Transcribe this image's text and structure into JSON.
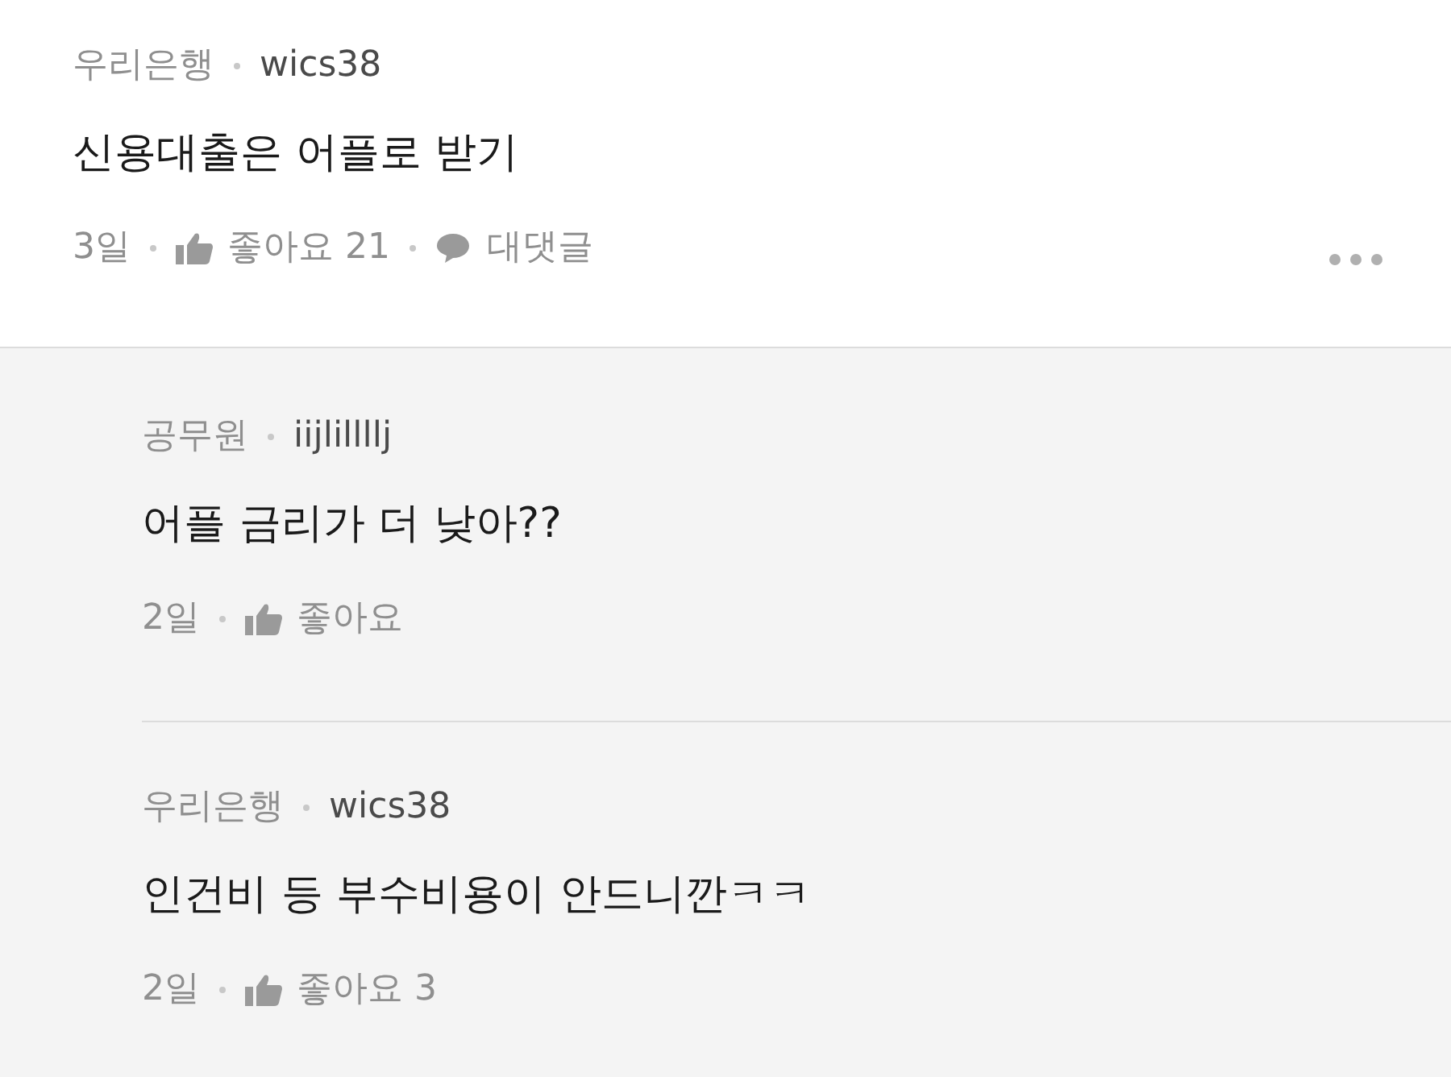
{
  "comment": {
    "group": "우리은행",
    "user": "wics38",
    "text": "신용대출은 어플로 받기",
    "age": "3일",
    "likes": "좋아요 21",
    "reply": "대댓글"
  },
  "replies": [
    {
      "group": "공무원",
      "user": "iijlillllj",
      "text": "어플 금리가 더 낮아??",
      "age": "2일",
      "likes": "좋아요"
    },
    {
      "group": "우리은행",
      "user": "wics38",
      "text": "인건비 등 부수비용이 안드니깐ㅋㅋ",
      "age": "2일",
      "likes": "좋아요 3"
    }
  ]
}
